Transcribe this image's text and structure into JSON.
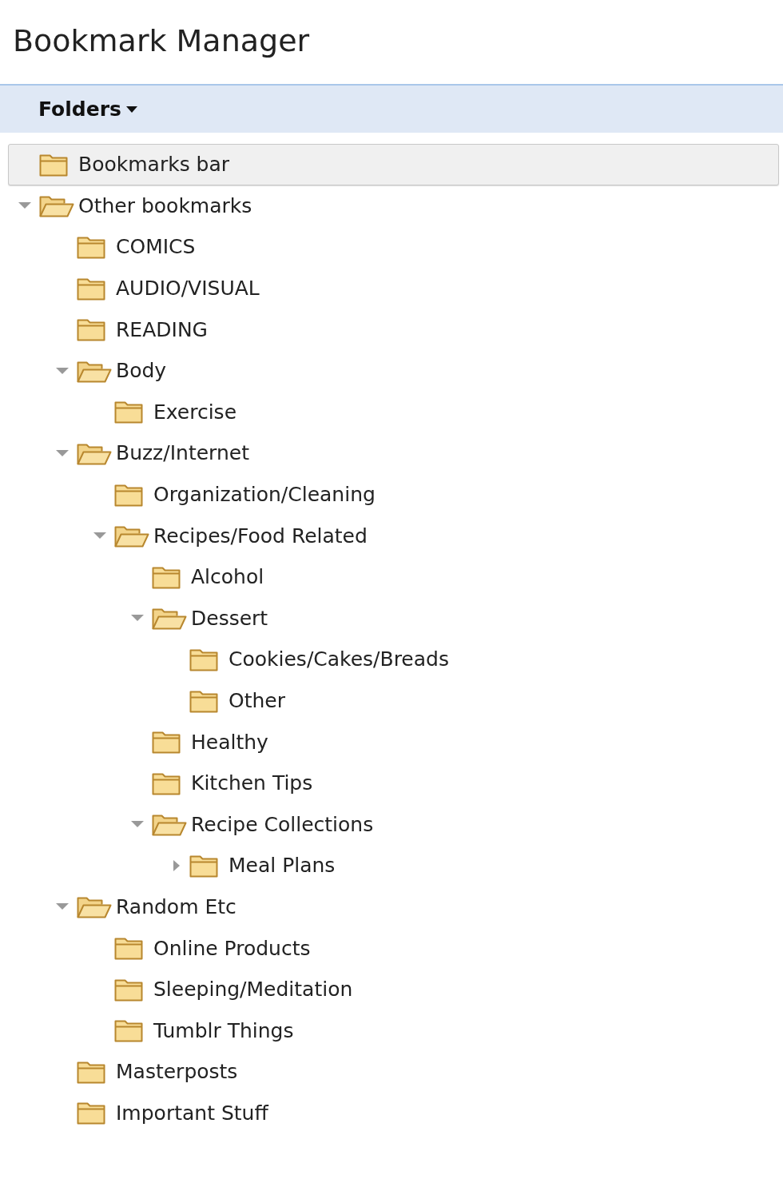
{
  "title": "Bookmark Manager",
  "toolbar": {
    "menu_label": "Folders"
  },
  "tree": [
    {
      "label": "Bookmarks bar",
      "selected": true
    },
    {
      "label": "Other bookmarks",
      "selected": false,
      "expanded": true,
      "children": [
        {
          "label": "COMICS",
          "selected": false
        },
        {
          "label": "AUDIO/VISUAL",
          "selected": false
        },
        {
          "label": "READING",
          "selected": false
        },
        {
          "label": "Body",
          "selected": false,
          "expanded": true,
          "children": [
            {
              "label": "Exercise",
              "selected": false
            }
          ]
        },
        {
          "label": "Buzz/Internet",
          "selected": false,
          "expanded": true,
          "children": [
            {
              "label": "Organization/Cleaning",
              "selected": false
            },
            {
              "label": "Recipes/Food Related",
              "selected": false,
              "expanded": true,
              "children": [
                {
                  "label": "Alcohol",
                  "selected": false
                },
                {
                  "label": "Dessert",
                  "selected": false,
                  "expanded": true,
                  "children": [
                    {
                      "label": "Cookies/Cakes/Breads",
                      "selected": false
                    },
                    {
                      "label": "Other",
                      "selected": false
                    }
                  ]
                },
                {
                  "label": "Healthy",
                  "selected": false
                },
                {
                  "label": "Kitchen Tips",
                  "selected": false
                },
                {
                  "label": "Recipe Collections",
                  "selected": false,
                  "expanded": true,
                  "children": [
                    {
                      "label": "Meal Plans",
                      "selected": false,
                      "expanded": false
                    }
                  ]
                }
              ]
            }
          ]
        },
        {
          "label": "Random Etc",
          "selected": false,
          "expanded": true,
          "children": [
            {
              "label": "Online Products",
              "selected": false
            },
            {
              "label": "Sleeping/Meditation",
              "selected": false
            },
            {
              "label": "Tumblr Things",
              "selected": false
            }
          ]
        },
        {
          "label": "Masterposts",
          "selected": false
        },
        {
          "label": "Important Stuff",
          "selected": false
        }
      ]
    }
  ]
}
